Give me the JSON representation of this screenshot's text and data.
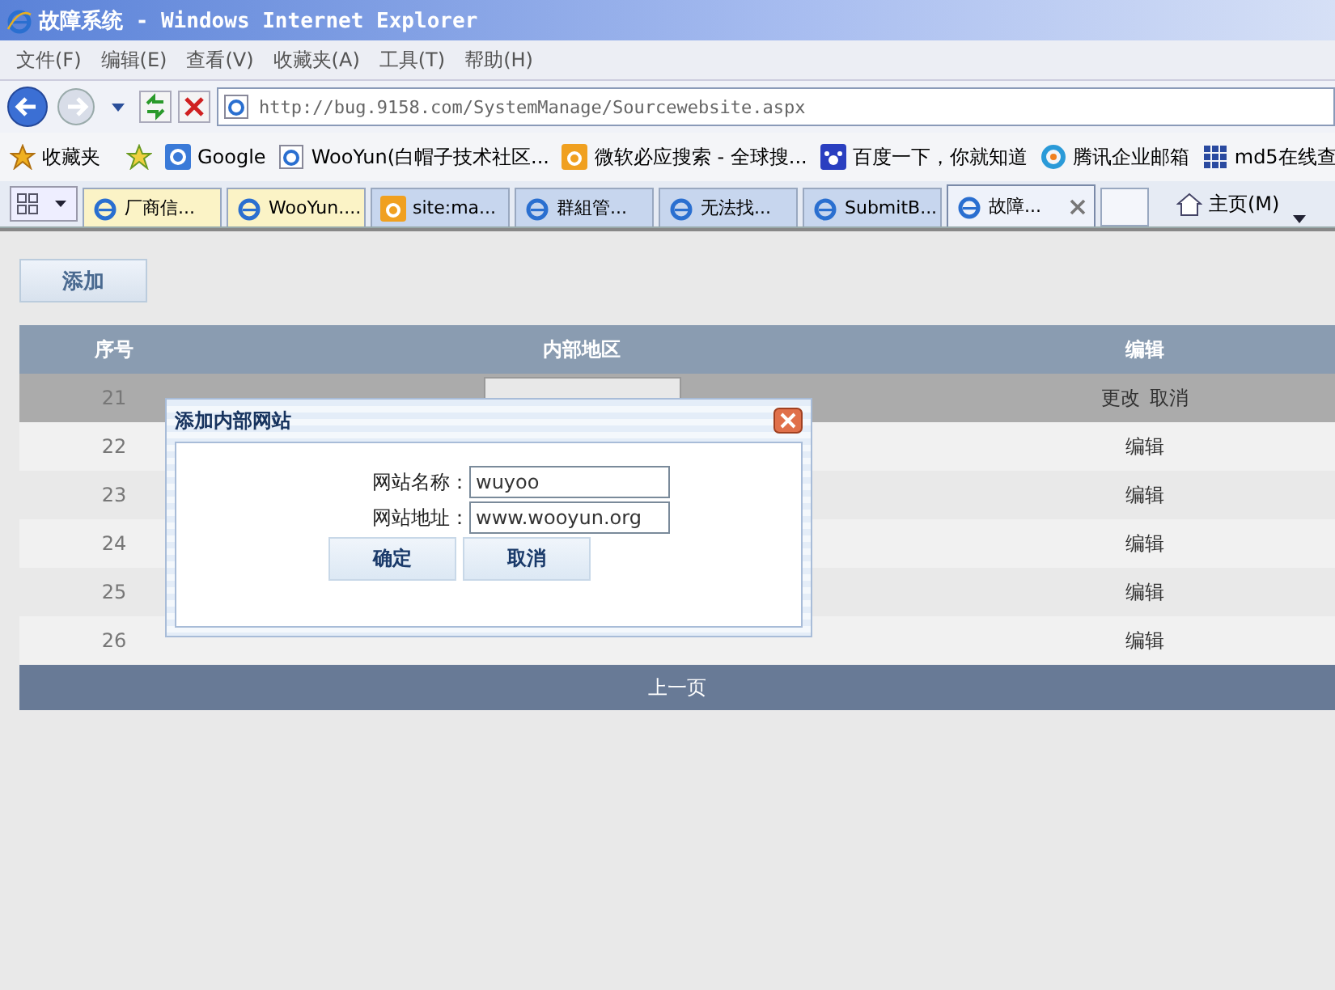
{
  "window": {
    "title": "故障系统 - Windows Internet Explorer"
  },
  "menu": [
    "文件(F)",
    "编辑(E)",
    "查看(V)",
    "收藏夹(A)",
    "工具(T)",
    "帮助(H)"
  ],
  "address": "http://bug.9158.com/SystemManage/Sourcewebsite.aspx",
  "favorites_label": "收藏夹",
  "favorites": [
    {
      "label": "Google"
    },
    {
      "label": "WooYun(白帽子技术社区..."
    },
    {
      "label": "微软必应搜索 - 全球搜..."
    },
    {
      "label": "百度一下，你就知道"
    },
    {
      "label": "腾讯企业邮箱"
    },
    {
      "label": "md5在线查"
    }
  ],
  "tabs": [
    {
      "label": "厂商信...",
      "color": "#fbf3c6",
      "selected": false
    },
    {
      "label": "WooYun....",
      "color": "#fbf3c6",
      "selected": false
    },
    {
      "label": "site:ma...",
      "color": "#c7d6ee",
      "selected": false
    },
    {
      "label": "群組管...",
      "color": "#c7d6ee",
      "selected": false
    },
    {
      "label": "无法找...",
      "color": "#c7d6ee",
      "selected": false
    },
    {
      "label": "SubmitB...",
      "color": "#c7d6ee",
      "selected": false
    },
    {
      "label": "故障...",
      "color": "#eef2fa",
      "selected": true
    }
  ],
  "home_label": "主页(M)",
  "add_button": "添加",
  "table": {
    "columns": [
      "序号",
      "内部地区",
      "编辑"
    ],
    "rows": [
      {
        "no": "21",
        "editing": true,
        "actions": [
          "更改",
          "取消"
        ]
      },
      {
        "no": "22",
        "editing": false,
        "actions": [
          "编辑"
        ]
      },
      {
        "no": "23",
        "editing": false,
        "actions": [
          "编辑"
        ]
      },
      {
        "no": "24",
        "editing": false,
        "actions": [
          "编辑"
        ]
      },
      {
        "no": "25",
        "editing": false,
        "actions": [
          "编辑"
        ]
      },
      {
        "no": "26",
        "editing": false,
        "actions": [
          "编辑"
        ]
      }
    ],
    "pager": "上一页"
  },
  "dialog": {
    "title": "添加内部网站",
    "fields": [
      {
        "label": "网站名称：",
        "value": "wuyoo"
      },
      {
        "label": "网站地址：",
        "value": "www.wooyun.org"
      }
    ],
    "buttons": [
      "确定",
      "取消"
    ]
  }
}
